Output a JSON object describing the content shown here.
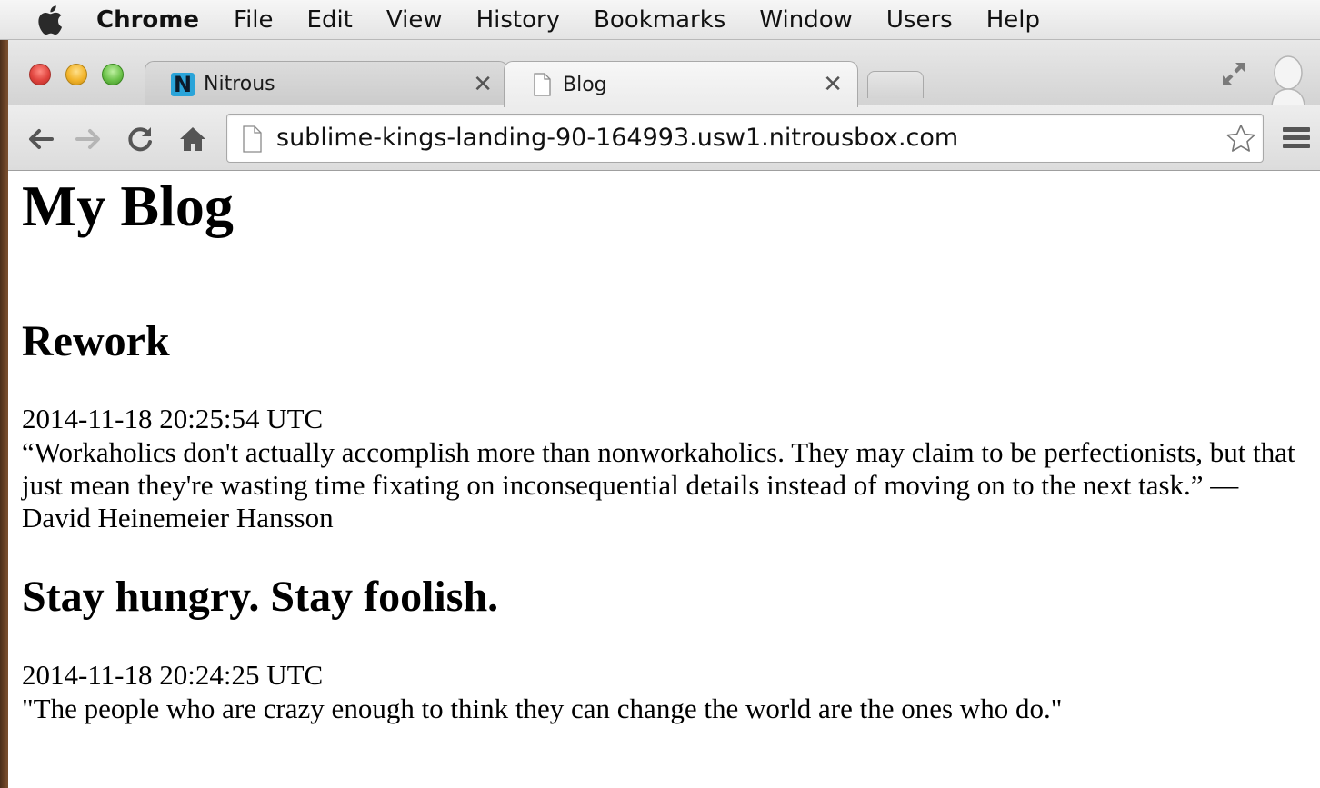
{
  "menubar": {
    "app_name": "Chrome",
    "items": [
      "File",
      "Edit",
      "View",
      "History",
      "Bookmarks",
      "Window",
      "Users",
      "Help"
    ]
  },
  "tabs": [
    {
      "title": "Nitrous",
      "favicon": "nitrous-n-icon",
      "active": false
    },
    {
      "title": "Blog",
      "favicon": "page-icon",
      "active": true
    }
  ],
  "toolbar": {
    "url": "sublime-kings-landing-90-164993.usw1.nitrousbox.com"
  },
  "page": {
    "title": "My Blog",
    "posts": [
      {
        "title": "Rework",
        "date": "2014-11-18 20:25:54 UTC",
        "body": "“Workaholics don't actually accomplish more than nonworkaholics. They may claim to be perfectionists, but that just mean they're wasting time fixating on inconsequential details instead of moving on to the next task.” ― David Heinemeier Hansson"
      },
      {
        "title": "Stay hungry. Stay foolish.",
        "date": "2014-11-18 20:24:25 UTC",
        "body": "\"The people who are crazy enough to think they can change the world are the ones who do.\""
      }
    ]
  },
  "colors": {
    "close": "#e0443e",
    "minimize": "#f2b42b",
    "maximize": "#6cc24a",
    "nitrous_brand": "#2aa4d9"
  }
}
